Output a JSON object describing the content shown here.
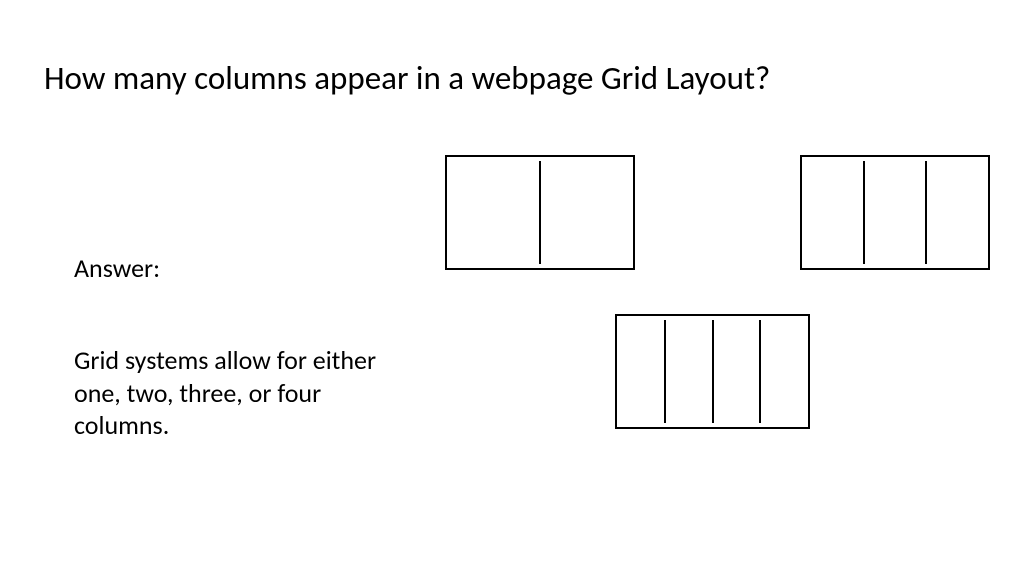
{
  "title": "How many columns appear in a webpage Grid Layout?",
  "answer_label": "Answer:",
  "answer_text": "Grid systems allow for either one, two, three, or four columns.",
  "diagrams": {
    "two_column": {
      "columns": 2
    },
    "three_column": {
      "columns": 3
    },
    "four_column": {
      "columns": 4
    }
  }
}
